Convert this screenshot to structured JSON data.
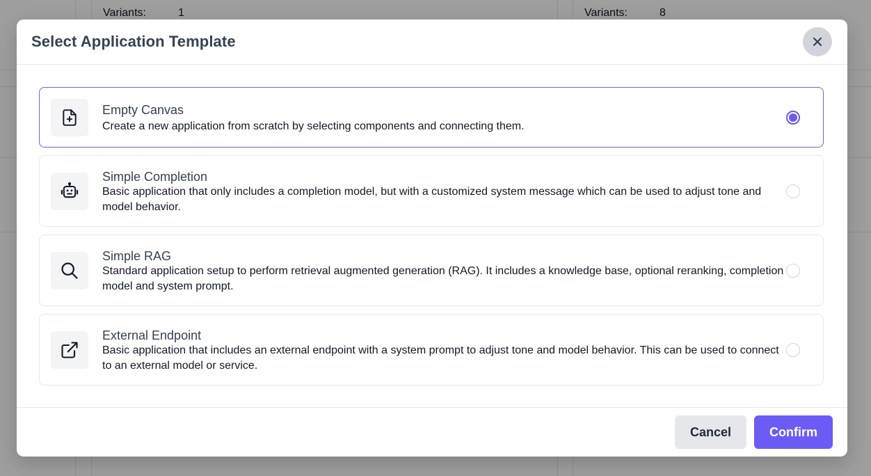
{
  "background": {
    "left_variants_label": "Variants:",
    "left_variants_value": "1",
    "right_variants_label": "Variants:",
    "right_variants_value": "8"
  },
  "modal": {
    "title": "Select Application Template",
    "close_icon": "close-icon",
    "options": [
      {
        "icon": "file-plus-icon",
        "title": "Empty Canvas",
        "description": "Create a new application from scratch by selecting components and connecting them.",
        "selected": true
      },
      {
        "icon": "robot-icon",
        "title": "Simple Completion",
        "description": "Basic application that only includes a completion model, but with a customized system message which can be used to adjust tone and model behavior.",
        "selected": false
      },
      {
        "icon": "search-icon",
        "title": "Simple RAG",
        "description": "Standard application setup to perform retrieval augmented generation (RAG). It includes a knowledge base, optional reranking, completion model and system prompt.",
        "selected": false
      },
      {
        "icon": "external-link-icon",
        "title": "External Endpoint",
        "description": "Basic application that includes an external endpoint with a system prompt to adjust tone and model behavior. This can be used to connect to an external model or service.",
        "selected": false
      }
    ],
    "footer": {
      "cancel_label": "Cancel",
      "confirm_label": "Confirm"
    }
  },
  "colors": {
    "accent": "#6b5cf6",
    "selected_border": "#7c5cd6"
  }
}
